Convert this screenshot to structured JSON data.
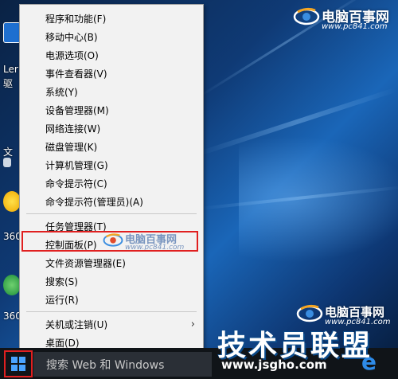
{
  "menu": {
    "items": [
      {
        "label": "程序和功能(F)"
      },
      {
        "label": "移动中心(B)"
      },
      {
        "label": "电源选项(O)"
      },
      {
        "label": "事件查看器(V)"
      },
      {
        "label": "系统(Y)"
      },
      {
        "label": "设备管理器(M)"
      },
      {
        "label": "网络连接(W)"
      },
      {
        "label": "磁盘管理(K)"
      },
      {
        "label": "计算机管理(G)"
      },
      {
        "label": "命令提示符(C)"
      },
      {
        "label": "命令提示符(管理员)(A)"
      },
      {
        "label": "任务管理器(T)"
      },
      {
        "label": "控制面板(P)"
      },
      {
        "label": "文件资源管理器(E)"
      },
      {
        "label": "搜索(S)"
      },
      {
        "label": "运行(R)"
      },
      {
        "label": "关机或注销(U)"
      },
      {
        "label": "桌面(D)"
      }
    ],
    "submenu_arrow": "›",
    "highlighted_item": "控制面板(P)"
  },
  "desktop": {
    "icons": [
      {
        "label": "Ler",
        "label2": "驱"
      },
      {
        "label": "文"
      },
      {
        "label": "360"
      },
      {
        "label": "360"
      }
    ]
  },
  "taskbar": {
    "search_placeholder": "搜索 Web 和 Windows",
    "start_icon": "windows-logo-icon",
    "edge_icon": "edge-icon",
    "edge_glyph": "e"
  },
  "watermarks": {
    "top_brand": "电脑百事网",
    "top_url": "www.pc841.com",
    "menu_brand": "电脑百事网",
    "menu_url": "www.pc841.com",
    "mid_brand": "电脑百事网",
    "mid_url": "www.pc841.com",
    "big_brand": "技术员联盟",
    "big_url": "www.jsgho.com"
  },
  "colors": {
    "highlight_border": "#e02020",
    "menu_bg": "#f2f2f2",
    "taskbar_bg": "#101418"
  }
}
